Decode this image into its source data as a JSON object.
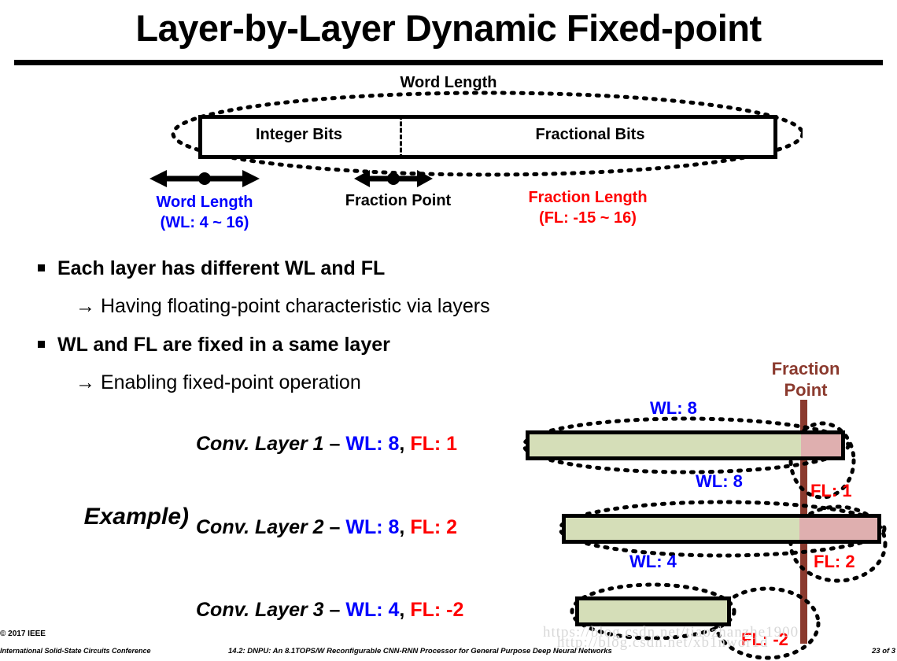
{
  "slide": {
    "title": "Layer-by-Layer Dynamic Fixed-point"
  },
  "word_diagram": {
    "word_length_label": "Word Length",
    "integer_bits_label": "Integer Bits",
    "fractional_bits_label": "Fractional Bits",
    "word_length_caption": "Word Length",
    "word_length_range": "(WL: 4 ~ 16)",
    "fraction_point_caption": "Fraction Point",
    "fraction_length_caption": "Fraction Length",
    "fraction_length_range": "(FL: -15 ~ 16)",
    "word_length_color": "#0000FF",
    "fraction_length_color": "#FF0000"
  },
  "bullets": [
    {
      "marker": "square",
      "text": "Each layer has different WL and FL"
    },
    {
      "marker": "arrow",
      "text": "→ Having floating-point characteristic via layers"
    },
    {
      "marker": "square",
      "text": "WL and FL are fixed in a same layer"
    },
    {
      "marker": "arrow",
      "text": "→ Enabling fixed-point operation"
    }
  ],
  "example": {
    "label": "Example)",
    "layers": [
      {
        "name": "Conv. Layer 1",
        "dash": " – ",
        "wl_label": "WL: 8",
        "comma": ", ",
        "fl_label": "FL: 1"
      },
      {
        "name": "Conv. Layer 2",
        "dash": " – ",
        "wl_label": "WL: 8",
        "comma": ", ",
        "fl_label": "FL: 2"
      },
      {
        "name": "Conv. Layer 3",
        "dash": " – ",
        "wl_label": "WL: 4",
        "comma": ", ",
        "fl_label": "FL: -2"
      }
    ]
  },
  "bar_diagram": {
    "fraction_point_title": "Fraction\nPoint",
    "fraction_point_title_line1": "Fraction",
    "fraction_point_title_line2": "Point",
    "fraction_point_color": "#8B3A2E",
    "integer_fill": "#D5DEB8",
    "fraction_fill": "#DFAFAF",
    "bars": [
      {
        "wl_tag": "WL: 8",
        "fl_tag": "FL: 1",
        "wl": 8,
        "fl": 1
      },
      {
        "wl_tag": "WL: 8",
        "fl_tag": "FL: 2",
        "wl": 8,
        "fl": 2
      },
      {
        "wl_tag": "WL: 4",
        "fl_tag": "FL: -2",
        "wl": 4,
        "fl": -2
      }
    ]
  },
  "footer": {
    "copyright": "© 2017 IEEE",
    "left": "International Solid-State Circuits Conference",
    "center": "14.2: DNPU: An 8.1TOPS/W Reconfigurable CNN-RNN Processor for General Purpose Deep Neural Networks",
    "page": "23 of 3",
    "watermark_1": "https://blog.csdn.net/tiaozhanzhe1900",
    "watermark_2": "http://blog.csdn.net/xb1nwor1d"
  }
}
